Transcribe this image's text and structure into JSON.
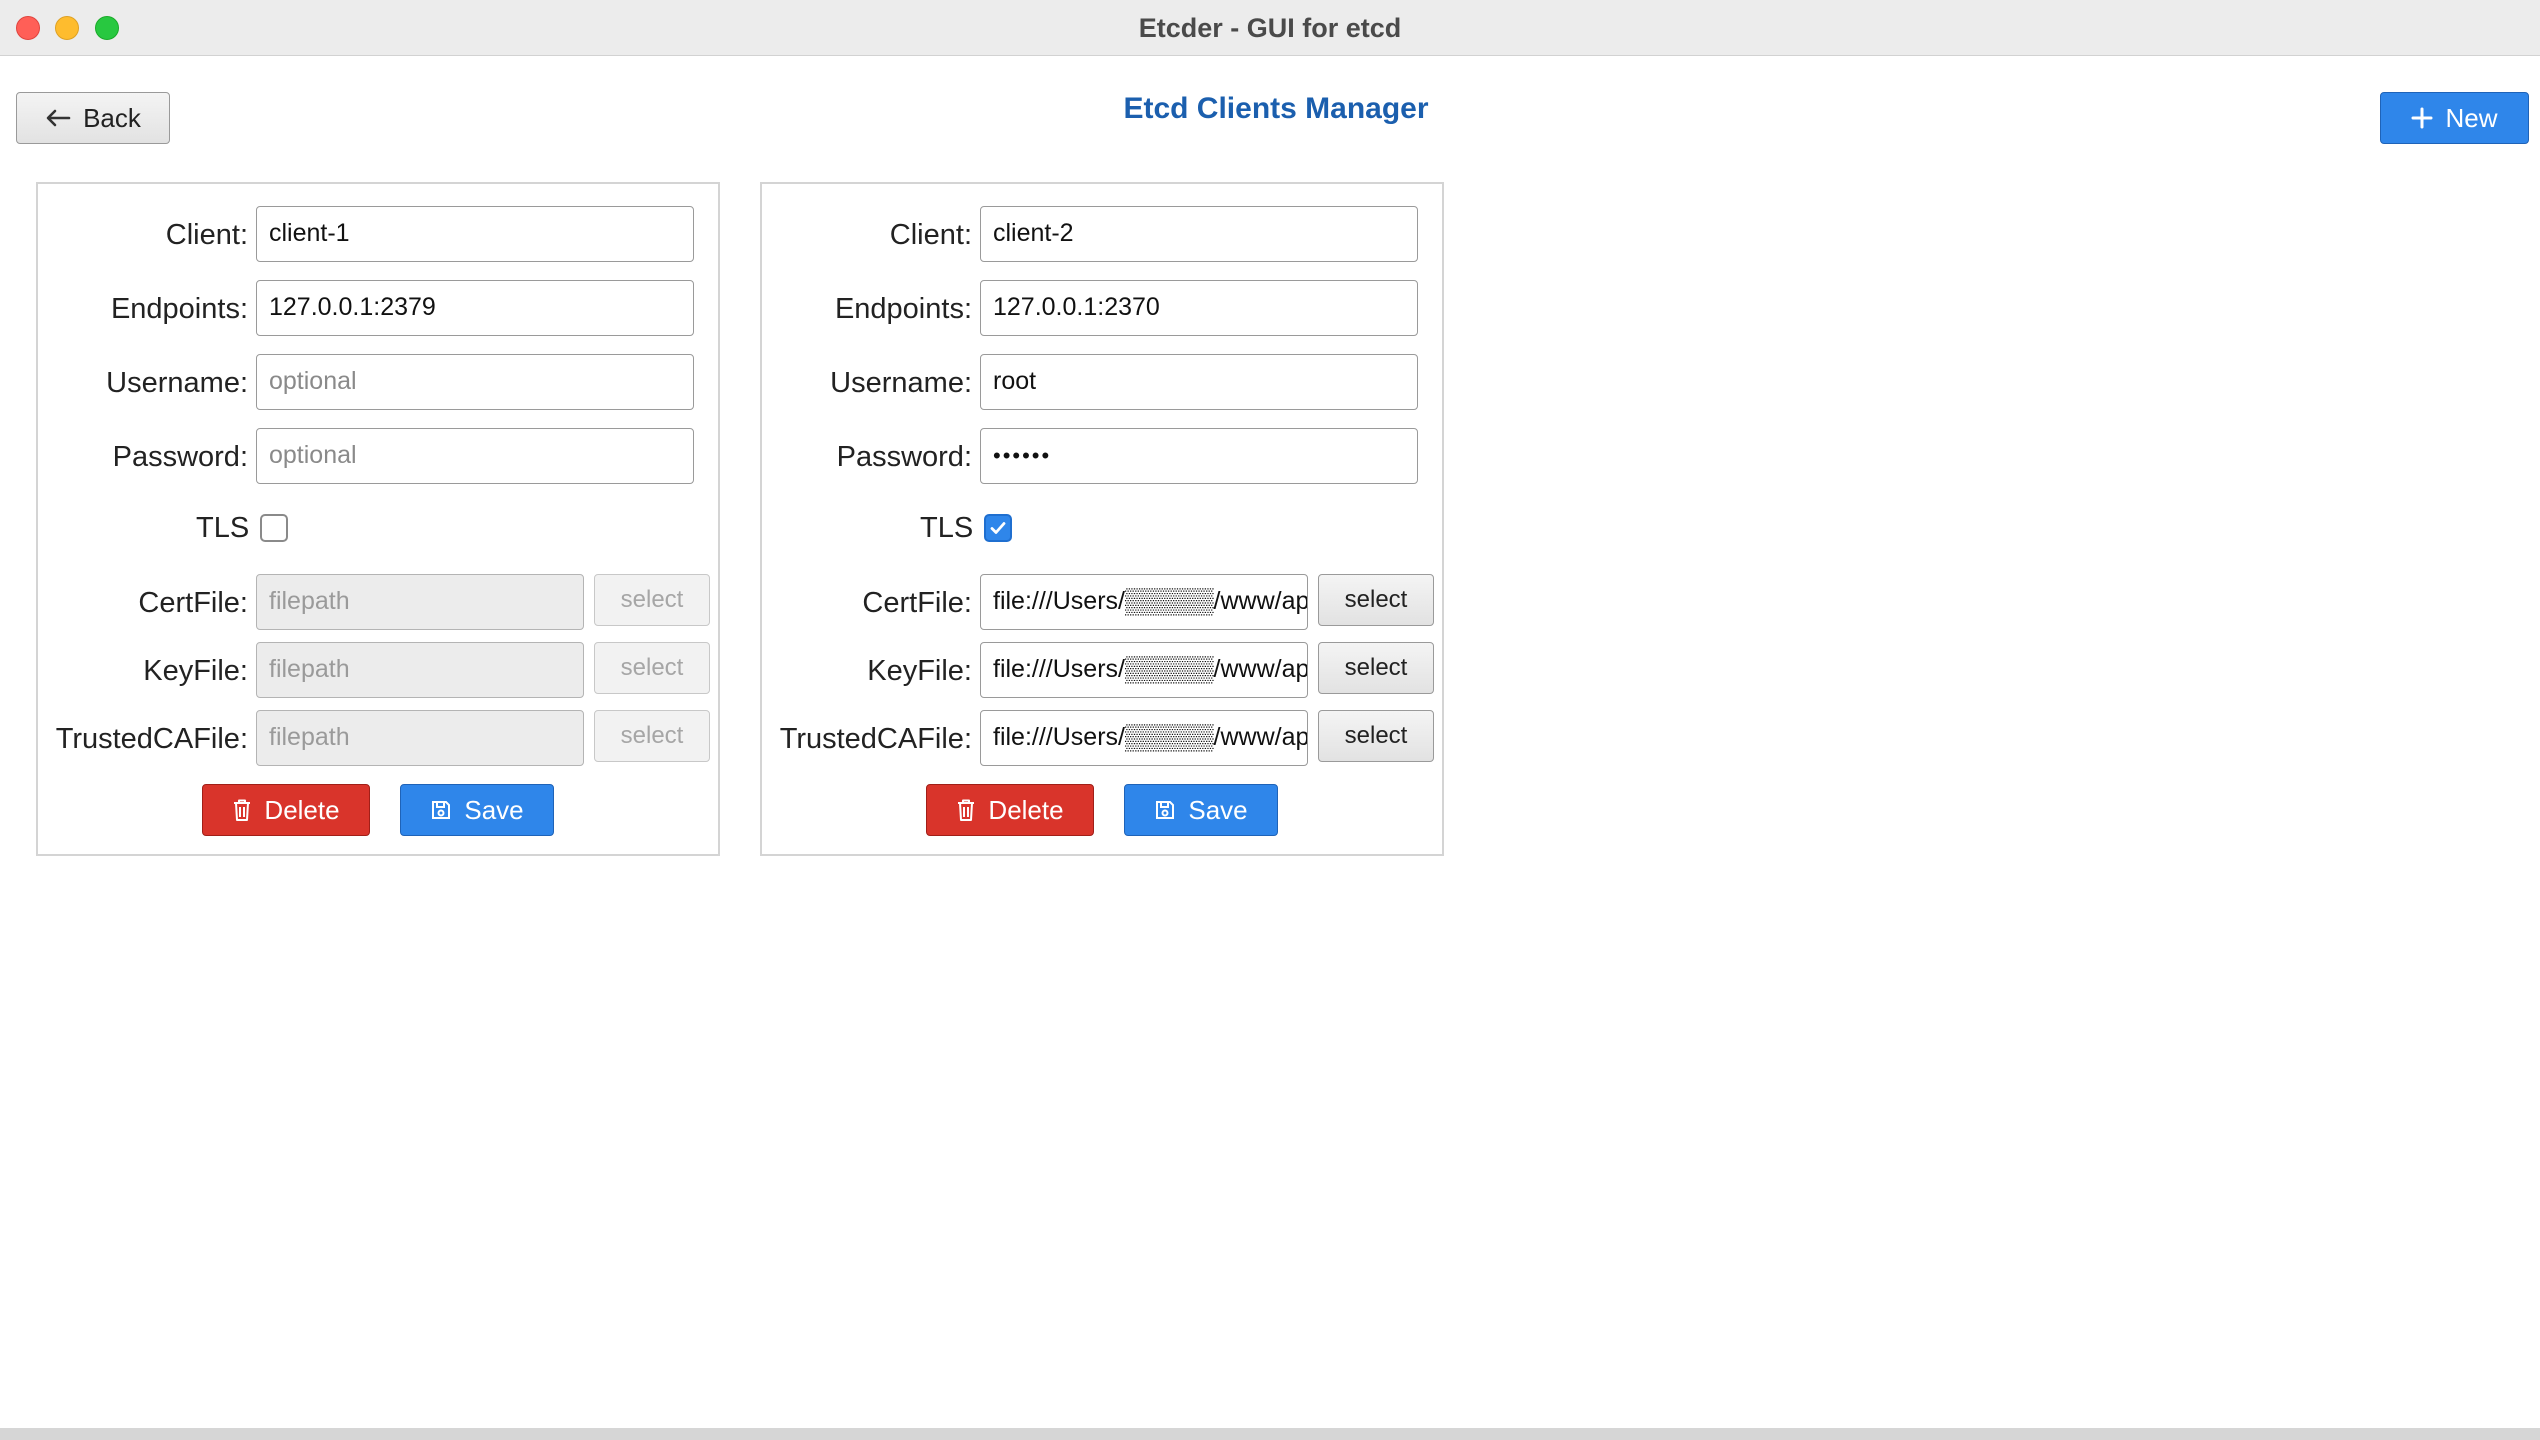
{
  "window": {
    "title": "Etcder - GUI for etcd"
  },
  "header": {
    "title": "Etcd Clients Manager",
    "back_label": "Back",
    "new_label": "New"
  },
  "labels": {
    "client": "Client:",
    "endpoints": "Endpoints:",
    "username": "Username:",
    "password": "Password:",
    "tls": "TLS",
    "certfile": "CertFile:",
    "keyfile": "KeyFile:",
    "trustedcafile": "TrustedCAFile:",
    "select": "select",
    "delete": "Delete",
    "save": "Save"
  },
  "clients": [
    {
      "client": "client-1",
      "endpoints": "127.0.0.1:2379",
      "username_placeholder": "optional",
      "password_placeholder": "optional",
      "tls": false,
      "certfile_placeholder": "filepath",
      "keyfile_placeholder": "filepath",
      "trustedcafile_placeholder": "filepath"
    },
    {
      "client": "client-2",
      "endpoints": "127.0.0.1:2370",
      "username": "root",
      "password_mask": "••••••",
      "tls": true,
      "certfile": "file:///Users/▒▒▒▒▒/www/ap",
      "keyfile": "file:///Users/▒▒▒▒▒/www/ap",
      "trustedcafile": "file:///Users/▒▒▒▒▒/www/ap"
    }
  ],
  "colors": {
    "accent": "#2f86ea",
    "danger": "#d9342b",
    "title": "#1b5fae"
  },
  "icons": {
    "back": "arrow-left-icon",
    "new": "plus-icon",
    "delete": "trash-icon",
    "save": "floppy-disk-icon",
    "check": "check-icon"
  }
}
